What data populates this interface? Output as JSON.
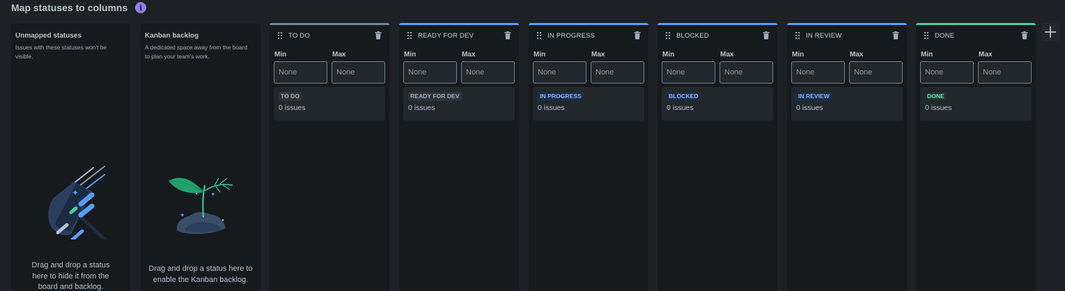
{
  "header": {
    "title": "Map statuses to columns",
    "info_icon": "info-icon"
  },
  "unmapped": {
    "title": "Unmapped statuses",
    "description_lines": [
      "Issues with these statuses won't be",
      "visible."
    ],
    "bottom_lines": [
      "Drag and drop a status",
      "here to hide it from the",
      "board and backlog."
    ],
    "illustration": "rocket-illustration"
  },
  "kanban": {
    "title": "Kanban backlog",
    "description_lines": [
      "A dedicated space away from the board",
      "to plan your team's work."
    ],
    "bottom_lines": [
      "Drag and drop a status here to",
      "enable the Kanban backlog."
    ],
    "illustration": "plant-illustration"
  },
  "labels": {
    "min": "Min",
    "max": "Max",
    "placeholder": "None"
  },
  "columns": [
    {
      "name": "TO DO",
      "status": "TO DO",
      "issues": "0 issues",
      "accent": "#738496",
      "lozenge_bg": "#2c333a",
      "lozenge_fg": "#9fadbc"
    },
    {
      "name": "READY FOR DEV",
      "status": "READY FOR DEV",
      "issues": "0 issues",
      "accent": "#579dff",
      "lozenge_bg": "#2c333a",
      "lozenge_fg": "#9fadbc"
    },
    {
      "name": "IN PROGRESS",
      "status": "IN PROGRESS",
      "issues": "0 issues",
      "accent": "#579dff",
      "lozenge_bg": "#1c2b41",
      "lozenge_fg": "#85b8ff"
    },
    {
      "name": "BLOCKED",
      "status": "BLOCKED",
      "issues": "0 issues",
      "accent": "#579dff",
      "lozenge_bg": "#1c2b41",
      "lozenge_fg": "#85b8ff"
    },
    {
      "name": "IN REVIEW",
      "status": "IN REVIEW",
      "issues": "0 issues",
      "accent": "#579dff",
      "lozenge_bg": "#1c2b41",
      "lozenge_fg": "#85b8ff"
    },
    {
      "name": "DONE",
      "status": "DONE",
      "issues": "0 issues",
      "accent": "#4bce97",
      "lozenge_bg": "#1c3329",
      "lozenge_fg": "#7ee2b8"
    }
  ],
  "add_column": {
    "icon": "plus-icon"
  }
}
